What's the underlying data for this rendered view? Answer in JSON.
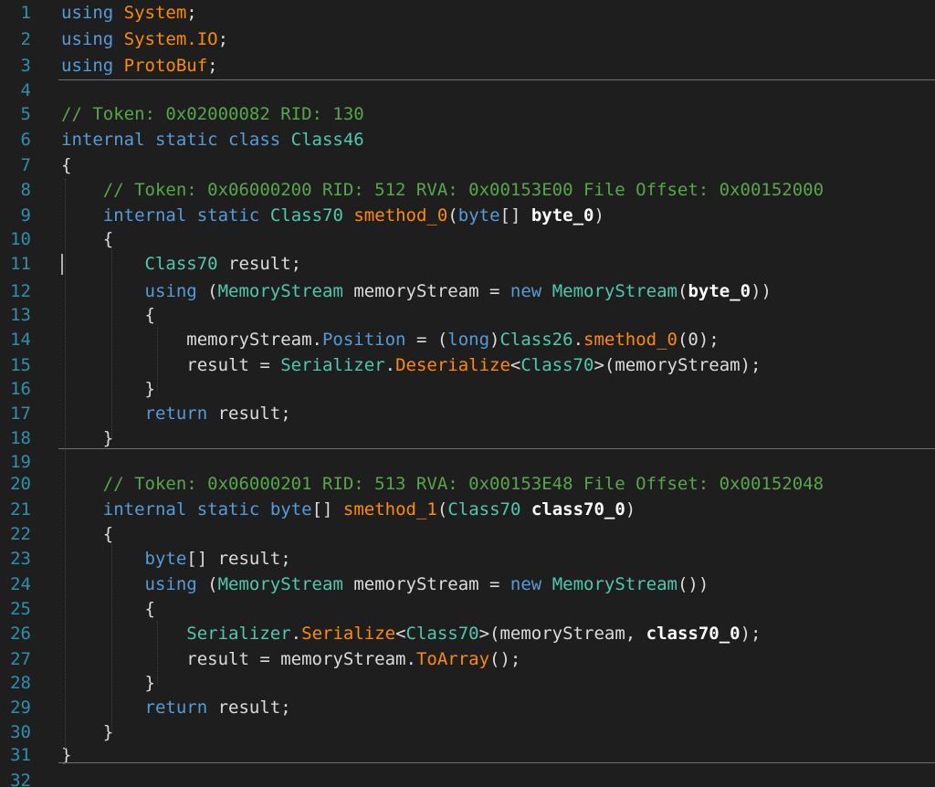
{
  "editor": {
    "lines": [
      {
        "n": "1",
        "tokens": [
          {
            "t": "using",
            "c": "kw"
          },
          {
            "t": " "
          },
          {
            "t": "System",
            "c": "mth"
          },
          {
            "t": ";"
          }
        ]
      },
      {
        "n": "2",
        "tokens": [
          {
            "t": "using",
            "c": "kw"
          },
          {
            "t": " "
          },
          {
            "t": "System.IO",
            "c": "mth"
          },
          {
            "t": ";"
          }
        ]
      },
      {
        "n": "3",
        "tokens": [
          {
            "t": "using",
            "c": "kw"
          },
          {
            "t": " "
          },
          {
            "t": "ProtoBuf",
            "c": "mth"
          },
          {
            "t": ";"
          }
        ]
      },
      {
        "n": "4",
        "tokens": []
      },
      {
        "n": "5",
        "tokens": [
          {
            "t": "// Token: 0x02000082 RID: 130",
            "c": "cm"
          }
        ]
      },
      {
        "n": "6",
        "tokens": [
          {
            "t": "internal static class",
            "c": "kw"
          },
          {
            "t": " "
          },
          {
            "t": "Class46",
            "c": "cls"
          }
        ]
      },
      {
        "n": "7",
        "tokens": [
          {
            "t": "{"
          }
        ]
      },
      {
        "n": "8",
        "tokens": [
          {
            "t": "    "
          },
          {
            "t": "// Token: 0x06000200 RID: 512 RVA: 0x00153E00 File Offset: 0x00152000",
            "c": "cm"
          }
        ]
      },
      {
        "n": "9",
        "tokens": [
          {
            "t": "    "
          },
          {
            "t": "internal static",
            "c": "kw"
          },
          {
            "t": " "
          },
          {
            "t": "Class70",
            "c": "cls"
          },
          {
            "t": " "
          },
          {
            "t": "smethod_0",
            "c": "mth"
          },
          {
            "t": "("
          },
          {
            "t": "byte",
            "c": "kw"
          },
          {
            "t": "[] "
          },
          {
            "t": "byte_0",
            "c": "par"
          },
          {
            "t": ")"
          }
        ]
      },
      {
        "n": "10",
        "tokens": [
          {
            "t": "    {"
          }
        ]
      },
      {
        "n": "11",
        "tokens": [
          {
            "t": "        "
          },
          {
            "t": "Class70",
            "c": "cls"
          },
          {
            "t": " result;"
          }
        ]
      },
      {
        "n": "12",
        "tokens": [
          {
            "t": "        "
          },
          {
            "t": "using",
            "c": "kw"
          },
          {
            "t": " ("
          },
          {
            "t": "MemoryStream",
            "c": "cls"
          },
          {
            "t": " memoryStream = "
          },
          {
            "t": "new",
            "c": "kw"
          },
          {
            "t": " "
          },
          {
            "t": "MemoryStream",
            "c": "cls"
          },
          {
            "t": "("
          },
          {
            "t": "byte_0",
            "c": "par"
          },
          {
            "t": "))"
          }
        ]
      },
      {
        "n": "13",
        "tokens": [
          {
            "t": "        {"
          }
        ]
      },
      {
        "n": "14",
        "tokens": [
          {
            "t": "            memoryStream."
          },
          {
            "t": "Position",
            "c": "prop"
          },
          {
            "t": " = ("
          },
          {
            "t": "long",
            "c": "kw"
          },
          {
            "t": ")"
          },
          {
            "t": "Class26",
            "c": "cls"
          },
          {
            "t": "."
          },
          {
            "t": "smethod_0",
            "c": "mth"
          },
          {
            "t": "(0);"
          }
        ]
      },
      {
        "n": "15",
        "tokens": [
          {
            "t": "            result = "
          },
          {
            "t": "Serializer",
            "c": "cls"
          },
          {
            "t": "."
          },
          {
            "t": "Deserialize",
            "c": "mth"
          },
          {
            "t": "<"
          },
          {
            "t": "Class70",
            "c": "cls"
          },
          {
            "t": ">(memoryStream);"
          }
        ]
      },
      {
        "n": "16",
        "tokens": [
          {
            "t": "        }"
          }
        ]
      },
      {
        "n": "17",
        "tokens": [
          {
            "t": "        "
          },
          {
            "t": "return",
            "c": "kw"
          },
          {
            "t": " result;"
          }
        ]
      },
      {
        "n": "18",
        "tokens": [
          {
            "t": "    }"
          }
        ]
      },
      {
        "n": "19",
        "tokens": []
      },
      {
        "n": "20",
        "tokens": [
          {
            "t": "    "
          },
          {
            "t": "// Token: 0x06000201 RID: 513 RVA: 0x00153E48 File Offset: 0x00152048",
            "c": "cm"
          }
        ]
      },
      {
        "n": "21",
        "tokens": [
          {
            "t": "    "
          },
          {
            "t": "internal static",
            "c": "kw"
          },
          {
            "t": " "
          },
          {
            "t": "byte",
            "c": "kw"
          },
          {
            "t": "[] "
          },
          {
            "t": "smethod_1",
            "c": "mth"
          },
          {
            "t": "("
          },
          {
            "t": "Class70",
            "c": "cls"
          },
          {
            "t": " "
          },
          {
            "t": "class70_0",
            "c": "par"
          },
          {
            "t": ")"
          }
        ]
      },
      {
        "n": "22",
        "tokens": [
          {
            "t": "    {"
          }
        ]
      },
      {
        "n": "23",
        "tokens": [
          {
            "t": "        "
          },
          {
            "t": "byte",
            "c": "kw"
          },
          {
            "t": "[] result;"
          }
        ]
      },
      {
        "n": "24",
        "tokens": [
          {
            "t": "        "
          },
          {
            "t": "using",
            "c": "kw"
          },
          {
            "t": " ("
          },
          {
            "t": "MemoryStream",
            "c": "cls"
          },
          {
            "t": " memoryStream = "
          },
          {
            "t": "new",
            "c": "kw"
          },
          {
            "t": " "
          },
          {
            "t": "MemoryStream",
            "c": "cls"
          },
          {
            "t": "())"
          }
        ]
      },
      {
        "n": "25",
        "tokens": [
          {
            "t": "        {"
          }
        ]
      },
      {
        "n": "26",
        "tokens": [
          {
            "t": "            "
          },
          {
            "t": "Serializer",
            "c": "cls"
          },
          {
            "t": "."
          },
          {
            "t": "Serialize",
            "c": "mth"
          },
          {
            "t": "<"
          },
          {
            "t": "Class70",
            "c": "cls"
          },
          {
            "t": ">(memoryStream, "
          },
          {
            "t": "class70_0",
            "c": "par"
          },
          {
            "t": ");"
          }
        ]
      },
      {
        "n": "27",
        "tokens": [
          {
            "t": "            result = memoryStream."
          },
          {
            "t": "ToArray",
            "c": "mth"
          },
          {
            "t": "();"
          }
        ]
      },
      {
        "n": "28",
        "tokens": [
          {
            "t": "        }"
          }
        ]
      },
      {
        "n": "29",
        "tokens": [
          {
            "t": "        "
          },
          {
            "t": "return",
            "c": "kw"
          },
          {
            "t": " result;"
          }
        ]
      },
      {
        "n": "30",
        "tokens": [
          {
            "t": "    }"
          }
        ]
      },
      {
        "n": "31",
        "tokens": [
          {
            "t": "}"
          }
        ]
      },
      {
        "n": "32",
        "tokens": []
      }
    ]
  },
  "colors": {
    "background": "#1e1e1e",
    "line_number": "#2b91af",
    "keyword": "#569cd6",
    "type": "#4ec9b0",
    "method": "#ff8c00",
    "comment": "#57a64a",
    "text": "#dcdcdc"
  }
}
